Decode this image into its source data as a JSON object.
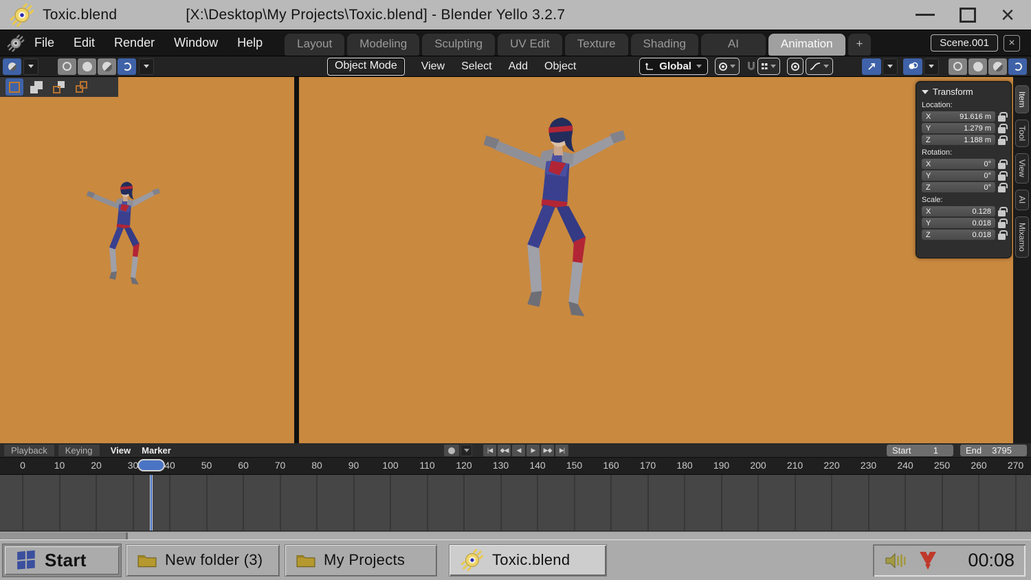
{
  "window": {
    "doc_title": "Toxic.blend",
    "title": "[X:\\Desktop\\My Projects\\Toxic.blend] - Blender Yello 3.2.7",
    "app_name": "Blender Yello 3.2.7",
    "close_glyph": "×"
  },
  "menubar": {
    "menus": [
      {
        "label": "File"
      },
      {
        "label": "Edit"
      },
      {
        "label": "Render"
      },
      {
        "label": "Window"
      },
      {
        "label": "Help"
      }
    ],
    "workspaces": [
      {
        "label": "Layout"
      },
      {
        "label": "Modeling"
      },
      {
        "label": "Sculpting"
      },
      {
        "label": "UV Edit"
      },
      {
        "label": "Texture"
      },
      {
        "label": "Shading"
      },
      {
        "label": "AI"
      },
      {
        "label": "Animation",
        "active": true
      }
    ],
    "add_workspace_label": "+",
    "scene_name": "Scene.001",
    "scene_close_glyph": "×"
  },
  "toolbar": {
    "mode_label": "Object Mode",
    "menus": [
      {
        "label": "View"
      },
      {
        "label": "Select"
      },
      {
        "label": "Add"
      },
      {
        "label": "Object"
      }
    ],
    "orientation_label": "Global"
  },
  "transform_panel": {
    "title": "Transform",
    "location": {
      "label": "Location:",
      "rows": [
        {
          "axis": "X",
          "value": "91.616 m"
        },
        {
          "axis": "Y",
          "value": "1.279 m"
        },
        {
          "axis": "Z",
          "value": "1.188 m"
        }
      ]
    },
    "rotation": {
      "label": "Rotation:",
      "rows": [
        {
          "axis": "X",
          "value": "0°"
        },
        {
          "axis": "Y",
          "value": "0°"
        },
        {
          "axis": "Z",
          "value": "0°"
        }
      ]
    },
    "scale": {
      "label": "Scale:",
      "rows": [
        {
          "axis": "X",
          "value": "0.128"
        },
        {
          "axis": "Y",
          "value": "0.018"
        },
        {
          "axis": "Z",
          "value": "0.018"
        }
      ]
    },
    "tabs": [
      {
        "label": "Item",
        "active": true
      },
      {
        "label": "Tool"
      },
      {
        "label": "View"
      },
      {
        "label": "AI"
      },
      {
        "label": "Mixamo"
      }
    ]
  },
  "timeline": {
    "menus": {
      "playback": "Playback",
      "keying": "Keying",
      "view": "View",
      "marker": "Marker"
    },
    "transport": [
      "|◀",
      "◆◀",
      "◀",
      "▶",
      "▶◆",
      "▶|"
    ],
    "start": {
      "label": "Start",
      "value": "1"
    },
    "end": {
      "label": "End",
      "value": "3795"
    },
    "current_frame": 35,
    "ruler": {
      "min": 0,
      "max": 270,
      "step": 10
    }
  },
  "taskbar": {
    "start_label": "Start",
    "buttons": [
      {
        "label": "New folder (3)"
      },
      {
        "label": "My Projects"
      },
      {
        "label": "Toxic.blend",
        "active": true
      }
    ],
    "clock": "00:08"
  },
  "colors": {
    "viewport_background": "#c9893f",
    "accent_blue": "#3f62a8",
    "playhead_blue": "#4a74c4",
    "titlebar_gray": "#b9b9b9",
    "taskbar_gray": "#ababab"
  }
}
